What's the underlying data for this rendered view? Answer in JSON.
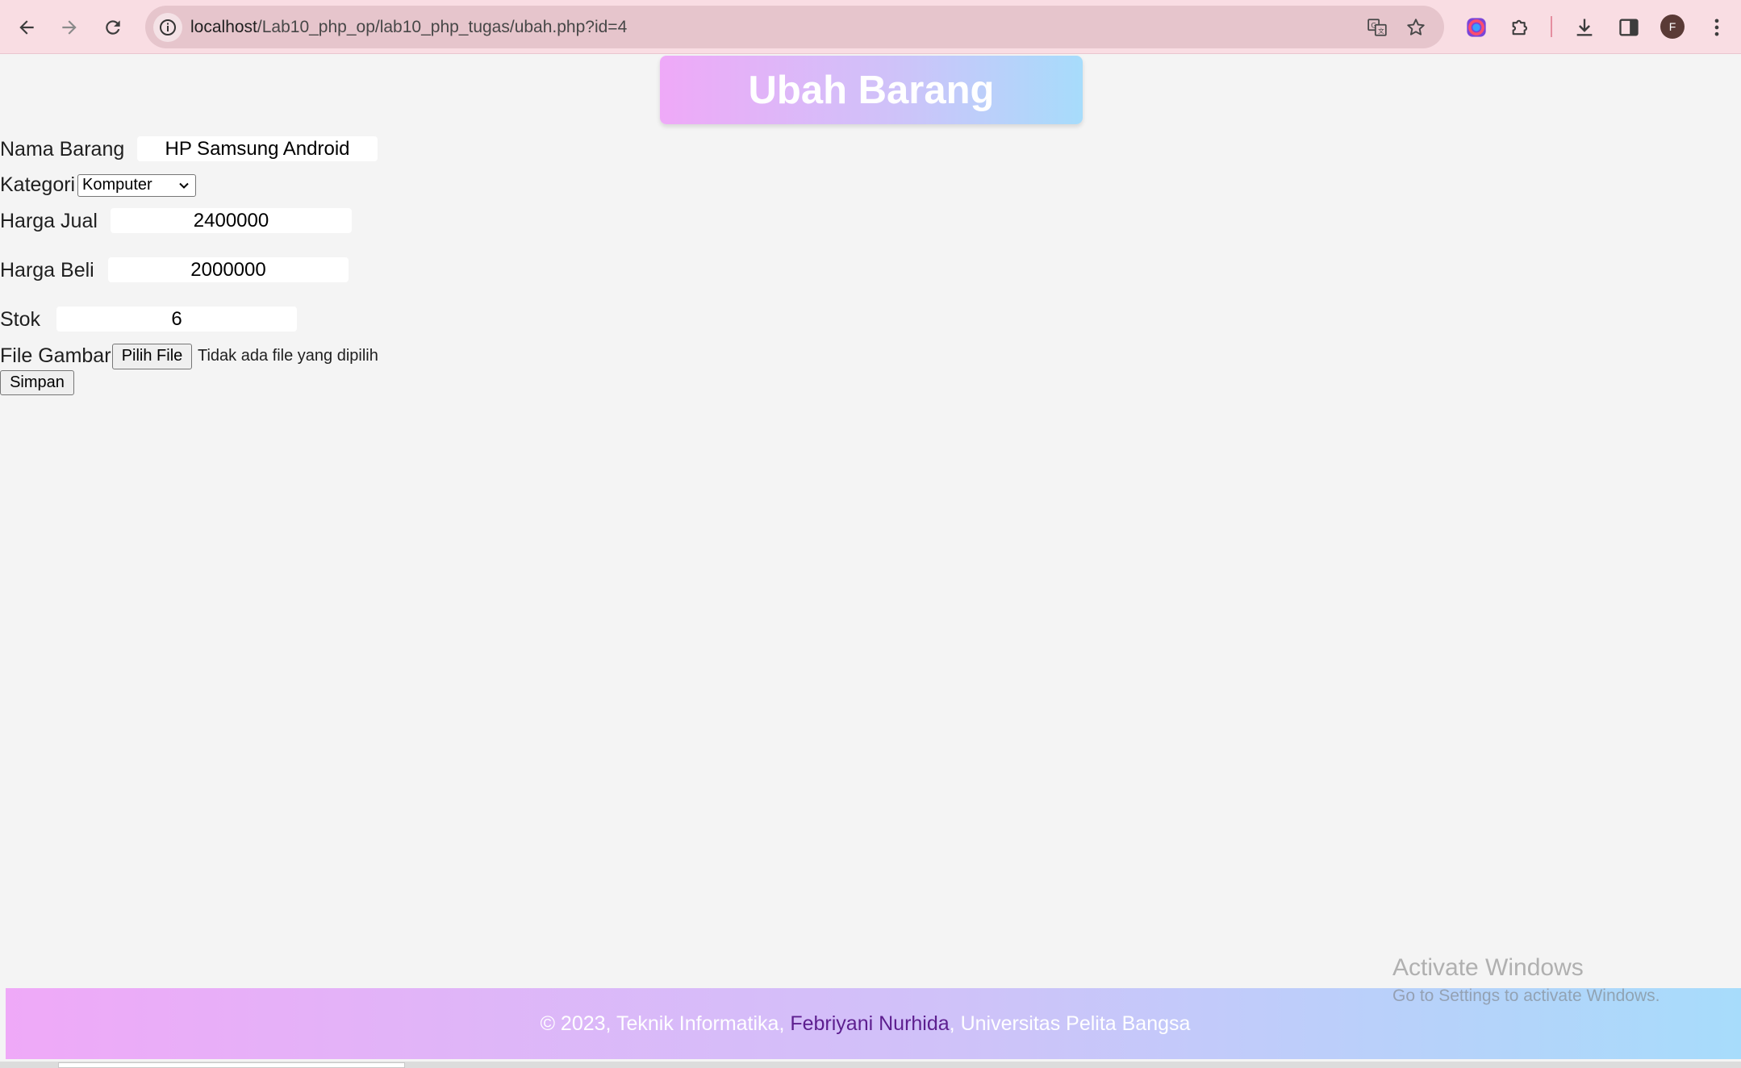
{
  "browser": {
    "url_host": "localhost",
    "url_path": "/Lab10_php_op/lab10_php_tugas/ubah.php?id=4",
    "profile_initial": "F",
    "icons": {
      "back": "arrow-left-icon",
      "forward": "arrow-right-icon",
      "reload": "reload-icon",
      "site_info": "info-icon",
      "translate": "translate-icon",
      "bookmark": "star-icon",
      "extension_color": "color-extension-icon",
      "extensions": "puzzle-icon",
      "downloads": "download-icon",
      "side_panel": "side-panel-icon",
      "menu": "kebab-menu-icon"
    }
  },
  "page": {
    "title": "Ubah Barang",
    "form": {
      "nama_label": "Nama Barang",
      "nama_value": "HP Samsung Android",
      "kategori_label": "Kategori",
      "kategori_selected": "Komputer",
      "harga_jual_label": "Harga Jual",
      "harga_jual_value": "2400000",
      "harga_beli_label": "Harga Beli",
      "harga_beli_value": "2000000",
      "stok_label": "Stok",
      "stok_value": "6",
      "file_label": "File Gambar",
      "file_button": "Pilih File",
      "file_status": "Tidak ada file yang dipilih",
      "submit_label": "Simpan"
    },
    "footer": {
      "part1": "© 2023, Teknik Informatika, ",
      "author": "Febriyani Nurhida",
      "part2": ", Universitas Pelita Bangsa"
    }
  },
  "watermark": {
    "line1": "Activate Windows",
    "line2": "Go to Settings to activate Windows."
  },
  "colors": {
    "gradient_start": "#efa9f8",
    "gradient_end": "#a7dcfb",
    "chrome_bg": "#f9dde3",
    "footer_link": "#5d1e8f"
  }
}
